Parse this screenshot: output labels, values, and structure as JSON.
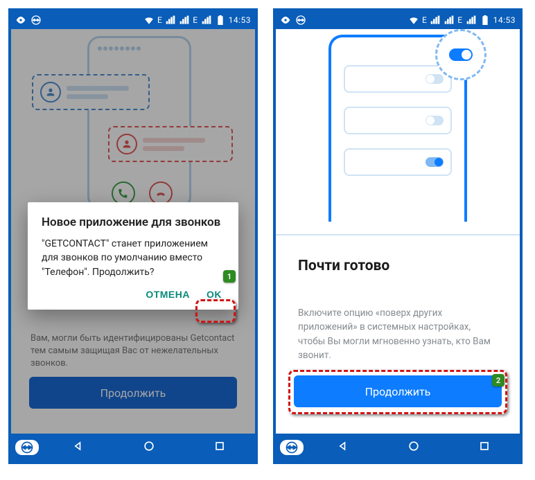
{
  "statusbar": {
    "network_label": "E",
    "time_left": "14:53",
    "time_right": "14:53",
    "icons_left": [
      "eye-icon",
      "teamviewer-icon"
    ],
    "icons_right": [
      "wifi-icon",
      "signal-icon",
      "signal-icon",
      "battery-icon"
    ]
  },
  "colors": {
    "primary": "#0a5db8",
    "accent_blue": "#0d7cff",
    "accent_teal": "#0a8a7a",
    "danger": "#d21414",
    "badge_green": "#2e8a22"
  },
  "left_screen": {
    "background_text": "Вам, могли быть идентифицированы Getcontact тем самым защищая Вас от нежелательных звонков.",
    "continue_label": "Продолжить",
    "dialog": {
      "title": "Новое приложение для звонков",
      "body": "\"GETCONTACT\" станет приложением для звонков по умолчанию вместо \"Телефон\". Продолжить?",
      "cancel_label": "ОТМЕНА",
      "ok_label": "OK"
    },
    "step_badge": "1"
  },
  "right_screen": {
    "heading": "Почти готово",
    "paragraph": "Включите опцию «поверх других приложений» в системных настройках, чтобы Вы могли мгновенно узнать, кто Вам звонит.",
    "continue_label": "Продолжить",
    "step_badge": "2"
  },
  "navbar": {
    "items": [
      "back",
      "home",
      "recent"
    ]
  }
}
